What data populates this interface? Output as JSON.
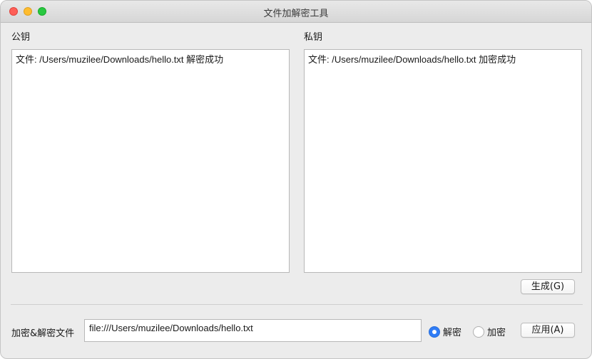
{
  "window": {
    "title": "文件加解密工具"
  },
  "public_key": {
    "label": "公钥",
    "content": "文件: /Users/muzilee/Downloads/hello.txt 解密成功"
  },
  "private_key": {
    "label": "私钥",
    "content": "文件: /Users/muzilee/Downloads/hello.txt 加密成功"
  },
  "generate_button": {
    "label": "生成(G)"
  },
  "file_section": {
    "label": "加密&解密文件",
    "path_value": "file:///Users/muzilee/Downloads/hello.txt",
    "mode_options": [
      {
        "label": "解密",
        "selected": true
      },
      {
        "label": "加密",
        "selected": false
      }
    ],
    "apply_label": "应用(A)"
  },
  "colors": {
    "accent": "#2f7cf6",
    "close": "#fe5f57",
    "minimize": "#febc2e",
    "maximize": "#28c840"
  }
}
